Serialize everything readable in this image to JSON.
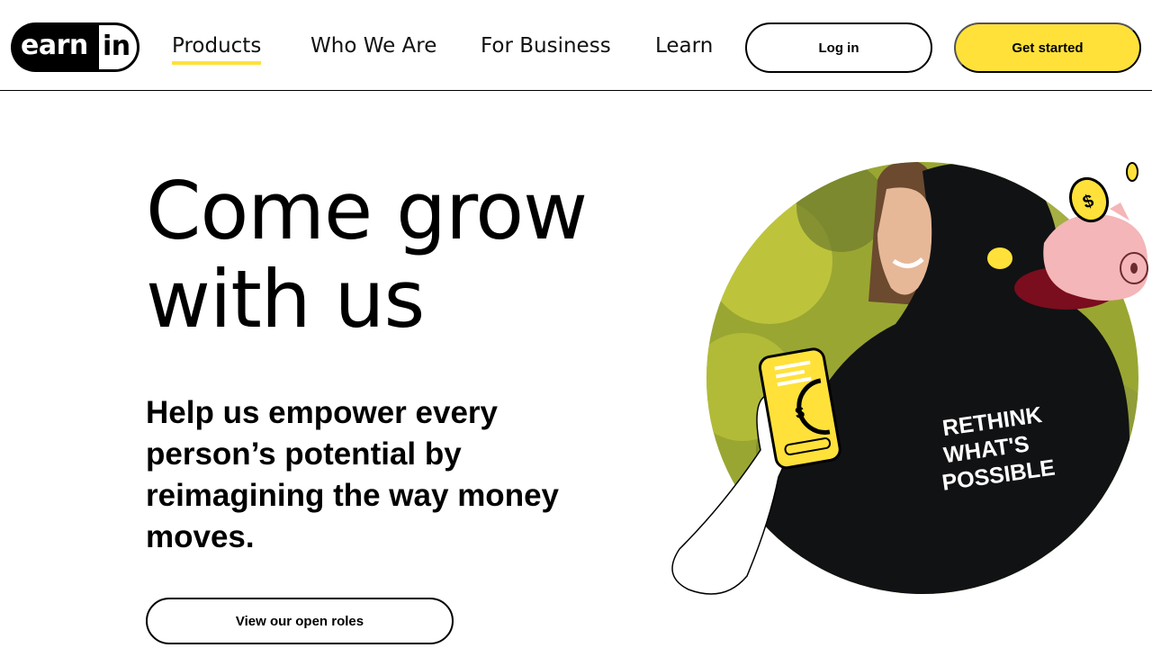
{
  "brand": {
    "logo_left": "earn",
    "logo_right": "in"
  },
  "nav": {
    "items": [
      {
        "label": "Products",
        "active": true
      },
      {
        "label": "Who We Are"
      },
      {
        "label": "For Business"
      },
      {
        "label": "Learn"
      }
    ],
    "login_label": "Log in",
    "get_started_label": "Get started"
  },
  "hero": {
    "title_line1": "Come grow",
    "title_line2": "with us",
    "subtitle": "Help us empower every person’s potential by reimagining the way money moves.",
    "cta_label": "View our open roles"
  },
  "illustration": {
    "hoodie_text_1": "RETHINK",
    "hoodie_text_2": "WHAT'S",
    "hoodie_text_3": "POSSIBLE",
    "phone_symbol": "$",
    "coin_symbol": "$"
  },
  "colors": {
    "accent": "#ffe13a",
    "text": "#000000",
    "background": "#ffffff",
    "piggy": "#f4b6b8"
  }
}
